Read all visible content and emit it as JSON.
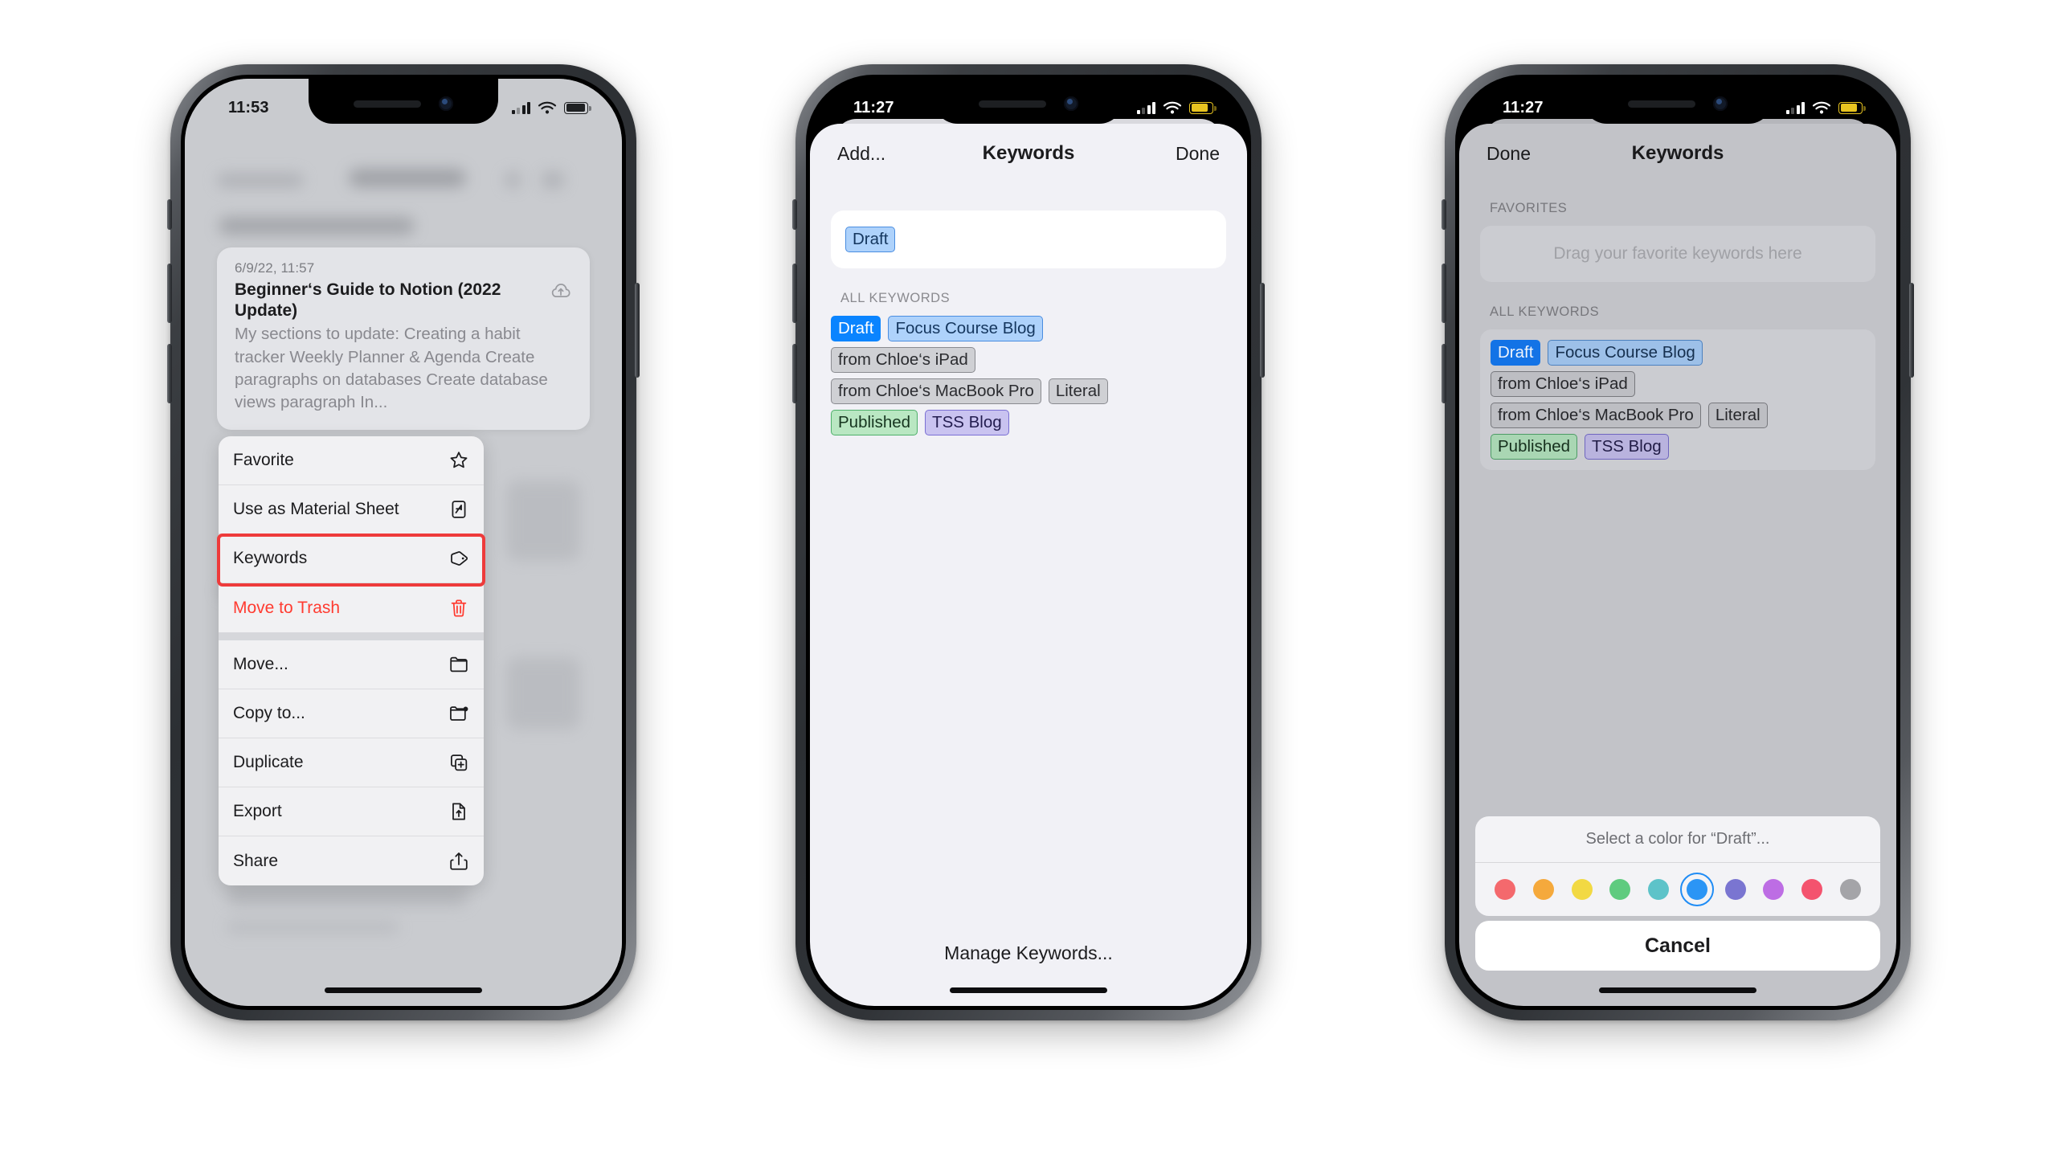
{
  "phone1": {
    "status": {
      "time": "11:53",
      "battery_state": "normal"
    },
    "note_card": {
      "date": "6/9/22, 11:57",
      "title": "Beginner‘s Guide to Notion (2022 Update)",
      "body": "My sections to update: Creating a habit tracker Weekly Planner & Agenda Create paragraphs on databases Create database views paragraph In...",
      "sync_icon": "cloud-upload-icon"
    },
    "context_menu": {
      "groups": [
        [
          {
            "label": "Favorite",
            "icon": "star-icon",
            "danger": false
          },
          {
            "label": "Use as Material Sheet",
            "icon": "material-sheet-icon",
            "danger": false
          },
          {
            "label": "Keywords",
            "icon": "tag-icon",
            "danger": false,
            "highlighted": true
          },
          {
            "label": "Move to Trash",
            "icon": "trash-icon",
            "danger": true
          }
        ],
        [
          {
            "label": "Move...",
            "icon": "folder-icon",
            "danger": false
          },
          {
            "label": "Copy to...",
            "icon": "folder-plus-icon",
            "danger": false
          },
          {
            "label": "Duplicate",
            "icon": "duplicate-icon",
            "danger": false
          },
          {
            "label": "Export",
            "icon": "export-icon",
            "danger": false
          },
          {
            "label": "Share",
            "icon": "share-icon",
            "danger": false
          }
        ]
      ],
      "highlight_color": "#ee3b3b"
    }
  },
  "phone2": {
    "status": {
      "time": "11:27",
      "battery_state": "low-power"
    },
    "nav": {
      "left": "Add...",
      "title": "Keywords",
      "right": "Done"
    },
    "assigned_field": {
      "tags": [
        {
          "label": "Draft",
          "style": "blue"
        }
      ]
    },
    "all_keywords_label": "ALL KEYWORDS",
    "all_keywords_rows": [
      [
        {
          "label": "Draft",
          "style": "sel"
        },
        {
          "label": "Focus Course Blog",
          "style": "blue"
        }
      ],
      [
        {
          "label": "from Chloe‘s iPad",
          "style": "gray"
        }
      ],
      [
        {
          "label": "from Chloe‘s MacBook Pro",
          "style": "gray"
        },
        {
          "label": "Literal",
          "style": "gray"
        }
      ],
      [
        {
          "label": "Published",
          "style": "green"
        },
        {
          "label": "TSS Blog",
          "style": "purple"
        }
      ]
    ],
    "footer": {
      "manage": "Manage Keywords..."
    }
  },
  "phone3": {
    "status": {
      "time": "11:27",
      "battery_state": "low-power"
    },
    "nav": {
      "left": "Done",
      "title": "Keywords"
    },
    "favorites_label": "FAVORITES",
    "favorites_placeholder": "Drag your favorite keywords here",
    "all_keywords_label": "ALL KEYWORDS",
    "all_keywords_rows": [
      [
        {
          "label": "Draft",
          "style": "sel"
        },
        {
          "label": "Focus Course Blog",
          "style": "blue"
        }
      ],
      [
        {
          "label": "from Chloe‘s iPad",
          "style": "gray"
        }
      ],
      [
        {
          "label": "from Chloe‘s MacBook Pro",
          "style": "gray"
        },
        {
          "label": "Literal",
          "style": "gray"
        }
      ],
      [
        {
          "label": "Published",
          "style": "green"
        },
        {
          "label": "TSS Blog",
          "style": "purple"
        }
      ]
    ],
    "action_sheet": {
      "title": "Select a color for “Draft”...",
      "colors": [
        {
          "name": "red",
          "hex": "#f4696d",
          "selected": false
        },
        {
          "name": "orange",
          "hex": "#f5a93c",
          "selected": false
        },
        {
          "name": "yellow",
          "hex": "#f2d943",
          "selected": false
        },
        {
          "name": "green",
          "hex": "#5fcb7f",
          "selected": false
        },
        {
          "name": "teal",
          "hex": "#5dc3c9",
          "selected": false
        },
        {
          "name": "blue",
          "hex": "#2b95f5",
          "selected": true
        },
        {
          "name": "indigo",
          "hex": "#7a75d1",
          "selected": false
        },
        {
          "name": "purple",
          "hex": "#bd6de4",
          "selected": false
        },
        {
          "name": "pink",
          "hex": "#f4536e",
          "selected": false
        },
        {
          "name": "gray",
          "hex": "#a4a4a8",
          "selected": false
        }
      ],
      "cancel": "Cancel"
    }
  }
}
